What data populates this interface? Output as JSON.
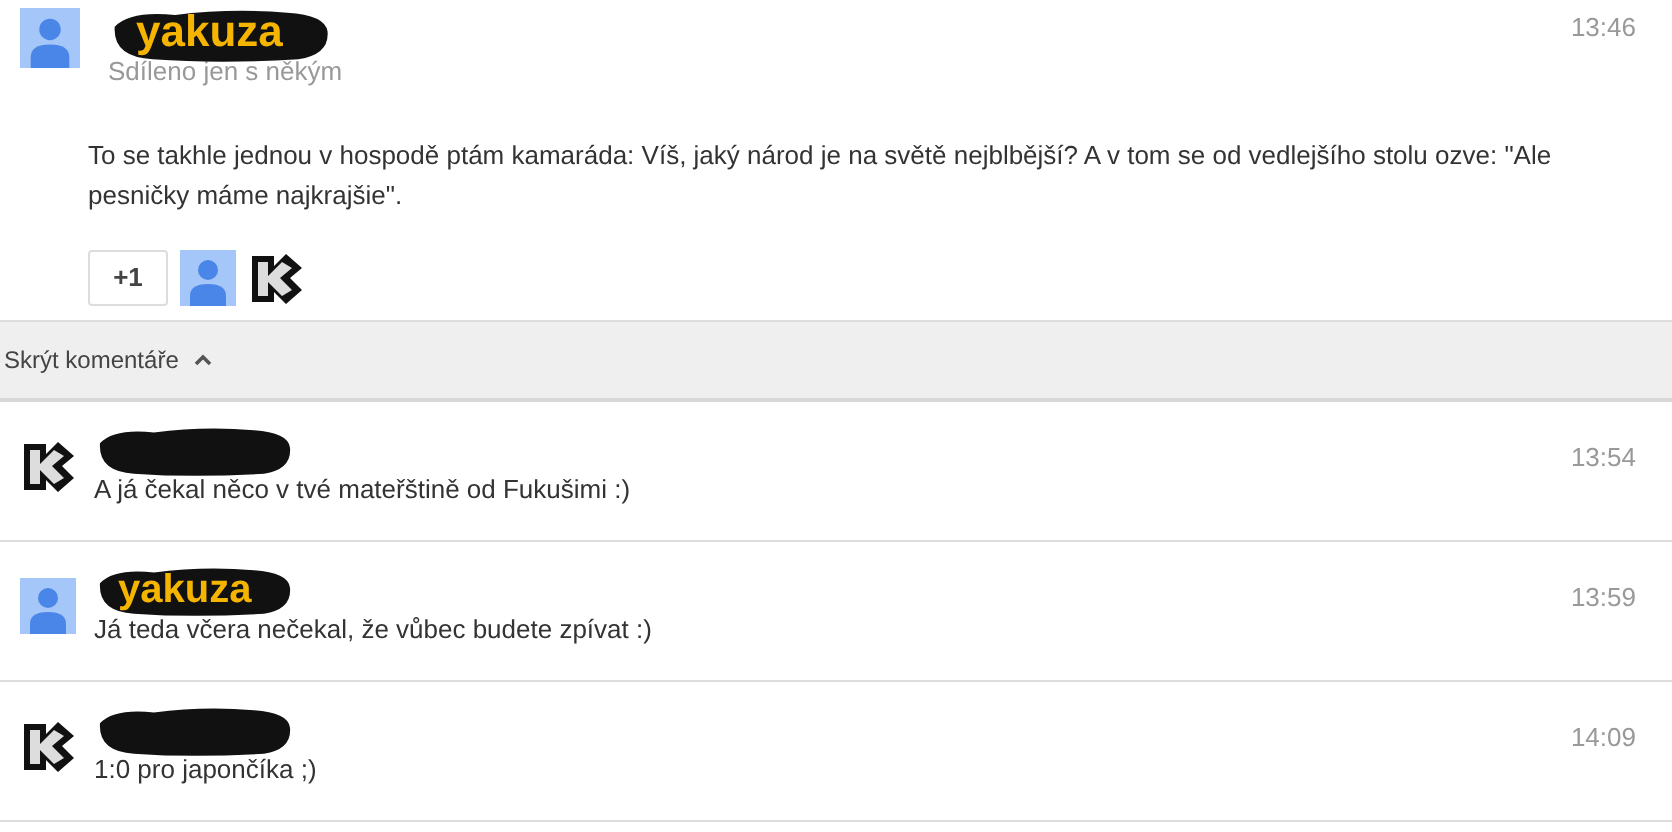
{
  "post": {
    "author": {
      "name": "yakuza",
      "redacted": true,
      "avatar": {
        "kind": "person"
      }
    },
    "sharing": "Sdíleno jen s někým",
    "time": "13:46",
    "text": "To se takhle jednou v hospodě ptám kamaráda: Víš, jaký národ je na světě nejblbější? A v tom se od vedlejšího stolu ozve: \"Ale pesničky máme najkrajšie\".",
    "plus_one": "+1",
    "plusers": [
      {
        "kind": "person"
      },
      {
        "kind": "k-logo"
      }
    ]
  },
  "comments_toggle": {
    "label": "Skrýt komentáře",
    "expanded": true
  },
  "comments": [
    {
      "redacted": true,
      "avatar": {
        "kind": "k-logo"
      },
      "time": "13:54",
      "text": "A já čekal něco v tvé mateřštině od Fukušimi :)"
    },
    {
      "name": "yakuza",
      "redacted": true,
      "avatar": {
        "kind": "person"
      },
      "time": "13:59",
      "text": "Já teda včera nečekal, že vůbec budete zpívat :)"
    },
    {
      "redacted": true,
      "avatar": {
        "kind": "k-logo"
      },
      "time": "14:09",
      "text": "1:0 pro japončíka ;)"
    }
  ]
}
